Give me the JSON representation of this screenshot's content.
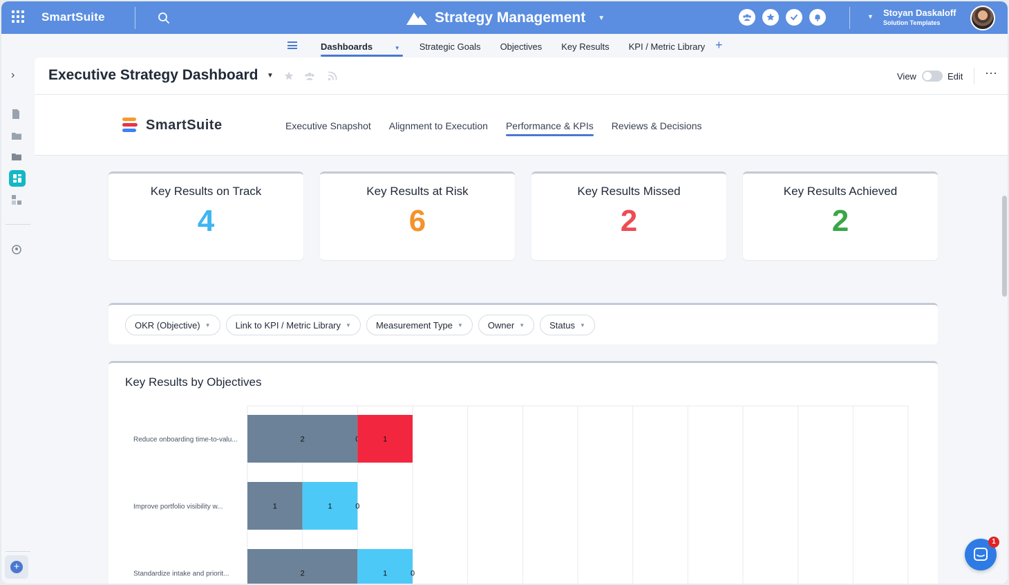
{
  "topbar": {
    "brand": "SmartSuite",
    "workspace_title": "Strategy Management",
    "user_name": "Stoyan Daskaloff",
    "user_role": "Solution Templates"
  },
  "nav": {
    "tabs": [
      "Dashboards",
      "Strategic Goals",
      "Objectives",
      "Key Results",
      "KPI / Metric Library"
    ],
    "active_tab": "Dashboards"
  },
  "dashboard": {
    "title": "Executive Strategy Dashboard",
    "view_label": "View",
    "edit_label": "Edit",
    "logo_text": "SmartSuite",
    "tabs": [
      "Executive Snapshot",
      "Alignment to Execution",
      "Performance & KPIs",
      "Reviews & Decisions"
    ],
    "active_tab": "Performance & KPIs"
  },
  "kpis": [
    {
      "label": "Key Results on Track",
      "value": "4",
      "color": "#3fb6f0"
    },
    {
      "label": "Key Results at Risk",
      "value": "6",
      "color": "#f5922b"
    },
    {
      "label": "Key Results Missed",
      "value": "2",
      "color": "#ee4b55"
    },
    {
      "label": "Key Results Achieved",
      "value": "2",
      "color": "#3aa648"
    }
  ],
  "filters": [
    "OKR (Objective)",
    "Link to KPI / Metric Library",
    "Measurement Type",
    "Owner",
    "Status"
  ],
  "chart_title": "Key Results by Objectives",
  "chart_data": {
    "type": "bar",
    "orientation": "horizontal",
    "stacked": true,
    "categories": [
      "Reduce onboarding time-to-valu...",
      "Improve portfolio visibility w...",
      "Standardize intake and priorit..."
    ],
    "series": [
      {
        "values": [
          2,
          1,
          2
        ],
        "color": "#6b8299"
      },
      {
        "values": [
          0,
          1,
          1
        ],
        "color": "#4cc9f7"
      },
      {
        "values": [
          1,
          0,
          0
        ],
        "color": "#f2263e"
      }
    ],
    "xlim": [
      0,
      12
    ],
    "grid": true
  },
  "chat_badge": "1"
}
